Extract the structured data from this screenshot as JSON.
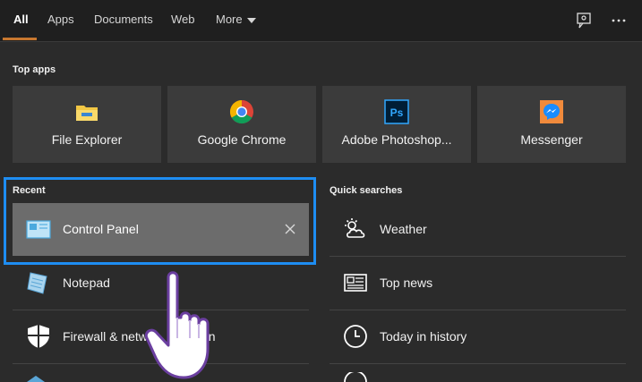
{
  "tabs": [
    {
      "label": "All"
    },
    {
      "label": "Apps"
    },
    {
      "label": "Documents"
    },
    {
      "label": "Web"
    },
    {
      "label": "More"
    }
  ],
  "sections": {
    "top_apps": "Top apps",
    "recent": "Recent",
    "quick_searches": "Quick searches"
  },
  "top_apps": [
    {
      "label": "File Explorer",
      "icon": "folder-icon"
    },
    {
      "label": "Google Chrome",
      "icon": "chrome-icon"
    },
    {
      "label": "Adobe Photoshop...",
      "icon": "photoshop-icon",
      "icon_text": "Ps"
    },
    {
      "label": "Messenger",
      "icon": "messenger-icon"
    }
  ],
  "recent": [
    {
      "label": "Control Panel",
      "icon": "control-panel-icon"
    },
    {
      "label": "Notepad",
      "icon": "notepad-icon"
    },
    {
      "label": "Firewall & netw",
      "label_tail": "on",
      "icon": "shield-icon"
    }
  ],
  "quick_searches": [
    {
      "label": "Weather",
      "icon": "weather-icon"
    },
    {
      "label": "Top news",
      "icon": "news-icon"
    },
    {
      "label": "Today in history",
      "icon": "clock-icon"
    }
  ],
  "colors": {
    "accent_underline": "#c7772f",
    "highlight_border": "#1e8df2",
    "tile_bg": "#3b3b3b",
    "selected_bg": "#6c6c6c"
  }
}
